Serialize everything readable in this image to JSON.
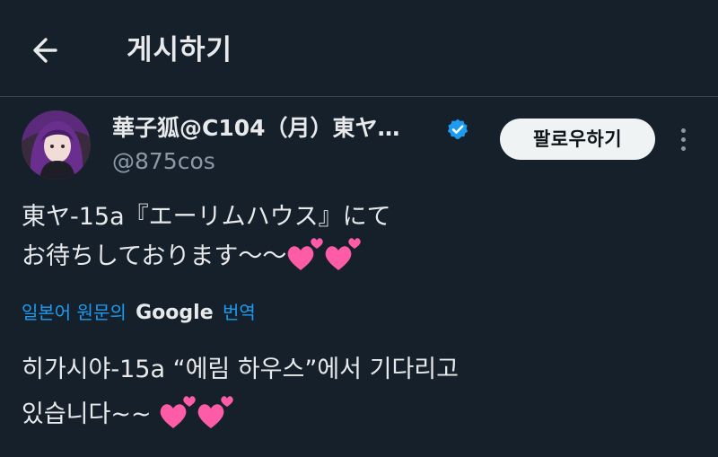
{
  "header": {
    "title": "게시하기"
  },
  "author": {
    "display_name": "華子狐@C104（月）東ヤ…",
    "handle": "@875cos",
    "verified": true,
    "follow_label": "팔로우하기"
  },
  "tweet": {
    "line1": "東ヤ-15a『エーリムハウス』にて",
    "line2": "お待ちしております〜〜"
  },
  "translation": {
    "label_prefix": "일본어 원문의",
    "brand": "Google",
    "label_suffix": "번역",
    "line1": "히가시야-15a “에림 하우스”에서 기다리고",
    "line2": "있습니다~~"
  },
  "icons": {
    "back": "arrow-left-icon",
    "verified": "verified-badge-icon",
    "more": "more-vertical-icon",
    "emoji": "two-hearts-emoji"
  },
  "colors": {
    "background": "#15202b",
    "link": "#1d9bf0",
    "verified": "#1d9bf0",
    "heart": "#ff5ca8"
  }
}
